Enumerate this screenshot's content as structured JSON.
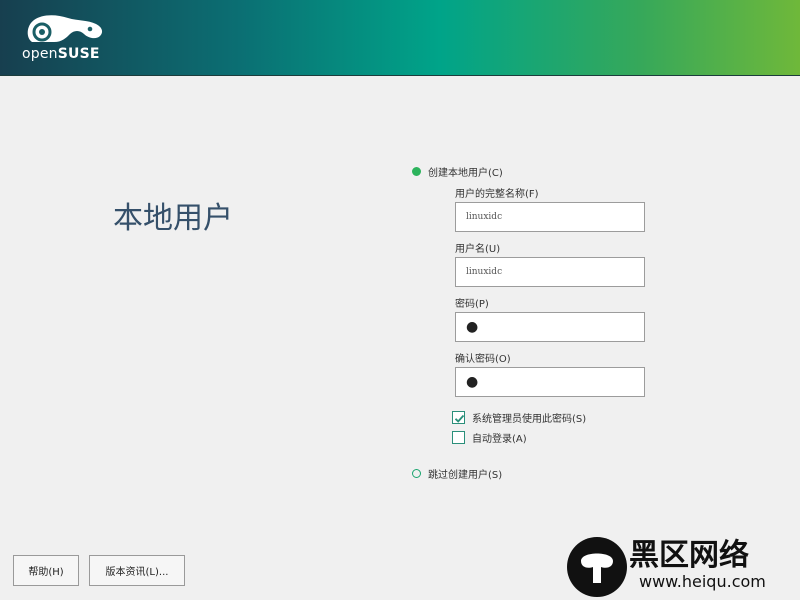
{
  "header": {
    "logo_prefix": "open",
    "logo_brand": "SUSE"
  },
  "page": {
    "title": "本地用户"
  },
  "form": {
    "create_user_option": "创建本地用户(C)",
    "fullname_label": "用户的完整名称(F)",
    "fullname_value": "linuxidc",
    "username_label": "用户名(U)",
    "username_value": "linuxidc",
    "password_label": "密码(P)",
    "password_value": "●",
    "confirm_label": "确认密码(O)",
    "confirm_value": "●",
    "admin_same_password_label": "系统管理员使用此密码(S)",
    "admin_same_password_checked": true,
    "autologin_label": "自动登录(A)",
    "autologin_checked": false,
    "skip_user_option": "跳过创建用户(S)",
    "selected_option": "create"
  },
  "footer": {
    "help_label": "帮助(H)",
    "release_notes_label": "版本资讯(L)..."
  },
  "watermark": {
    "line1": "黑区网络",
    "line2": "www.heiqu.com"
  },
  "colors": {
    "accent": "#2cb35c",
    "title": "#35506a"
  }
}
